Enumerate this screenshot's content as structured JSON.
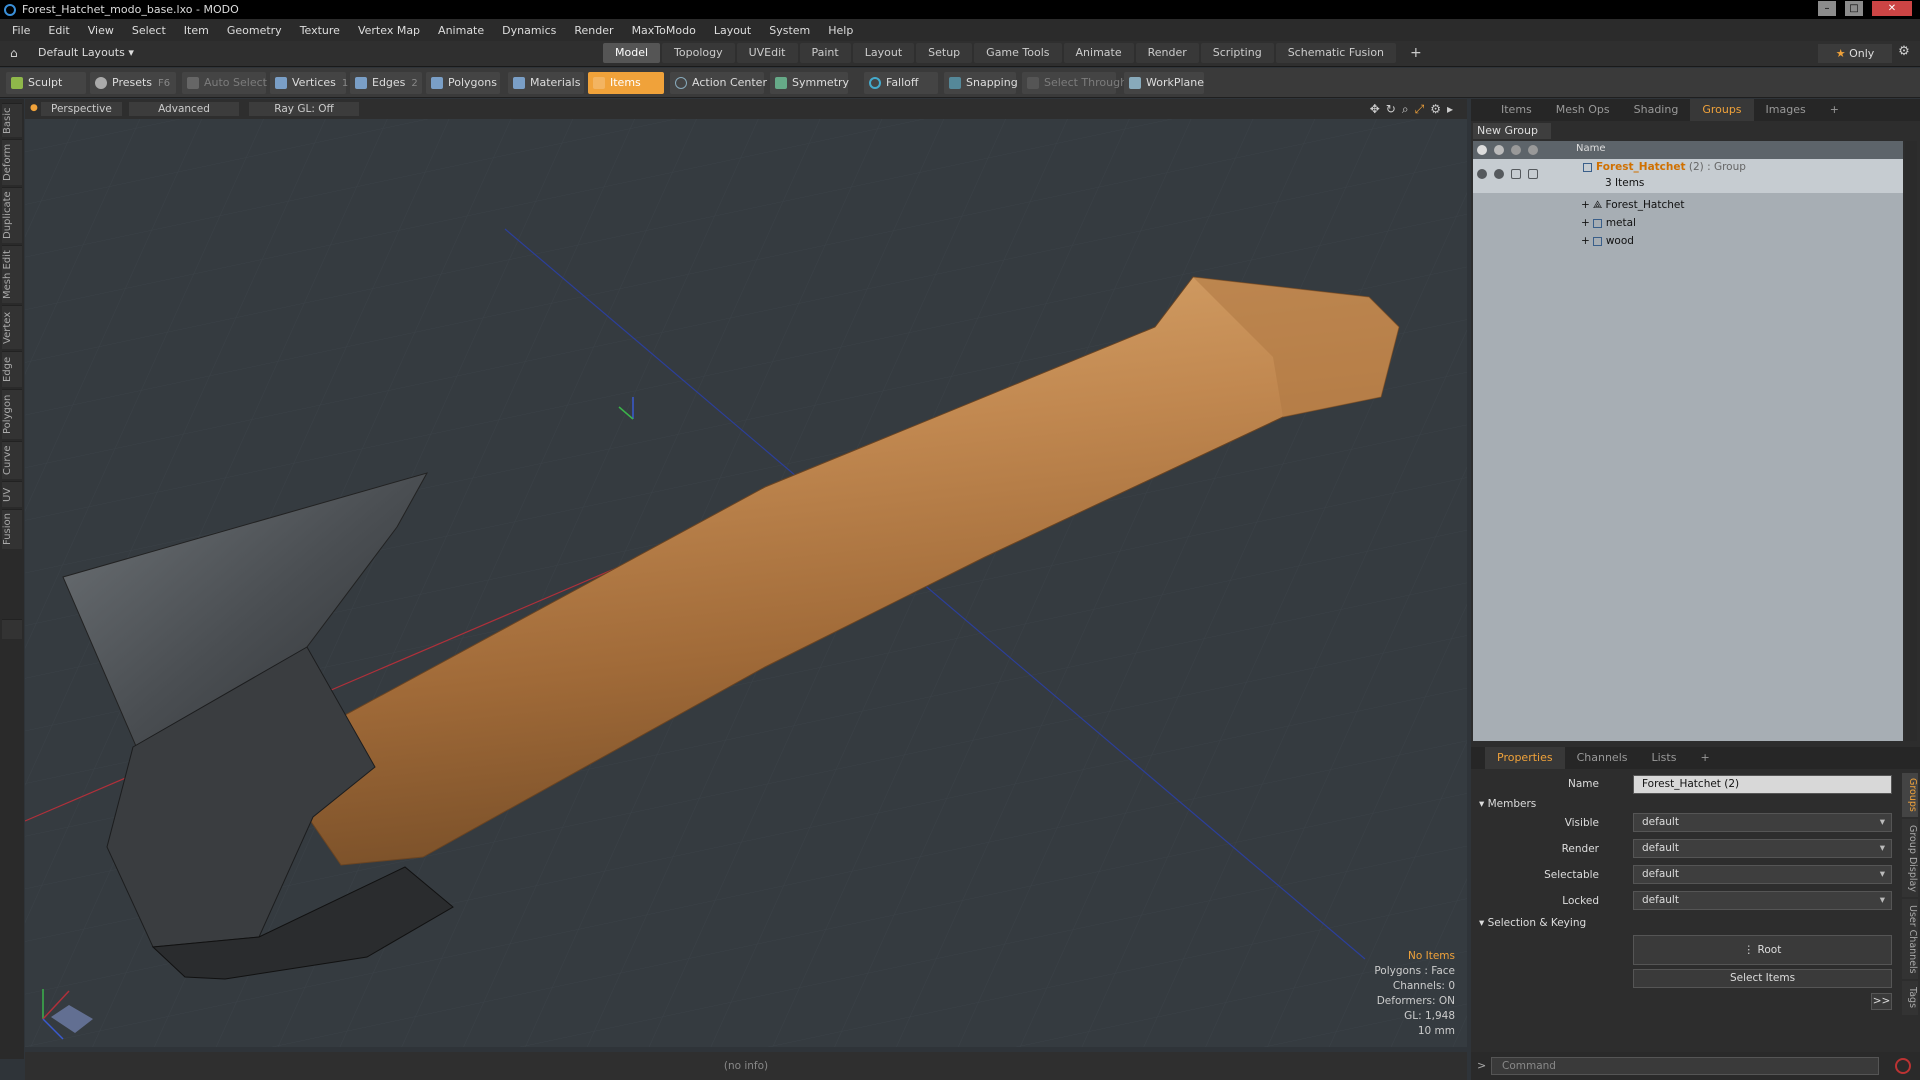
{
  "window": {
    "title": "Forest_Hatchet_modo_base.lxo - MODO"
  },
  "menu": [
    "File",
    "Edit",
    "View",
    "Select",
    "Item",
    "Geometry",
    "Texture",
    "Vertex Map",
    "Animate",
    "Dynamics",
    "Render",
    "MaxToModo",
    "Layout",
    "System",
    "Help"
  ],
  "layout": {
    "dropdown": "Default Layouts",
    "tabs": [
      "Model",
      "Topology",
      "UVEdit",
      "Paint",
      "Layout",
      "Setup",
      "Game Tools",
      "Animate",
      "Render",
      "Scripting",
      "Schematic Fusion"
    ],
    "active_tab": "Model",
    "add_symbol": "+",
    "only_label": "Only"
  },
  "toolbar": {
    "sculpt": "Sculpt",
    "presets": "Presets",
    "presets_key": "F6",
    "auto_select": "Auto Select",
    "vertices": "Vertices",
    "vertices_count": "1",
    "edges": "Edges",
    "edges_count": "2",
    "polygons": "Polygons",
    "materials": "Materials",
    "items": "Items",
    "action_center": "Action Center",
    "symmetry": "Symmetry",
    "falloff": "Falloff",
    "snapping": "Snapping",
    "select_through": "Select Through",
    "workplane": "WorkPlane"
  },
  "left_tabs": [
    "Basic",
    "Deform",
    "Duplicate",
    "Mesh Edit",
    "Vertex",
    "Edge",
    "Polygon",
    "Curve",
    "UV",
    "Fusion"
  ],
  "viewport": {
    "view": "Perspective",
    "shading": "Advanced",
    "raygl": "Ray GL: Off",
    "info": {
      "items": "No Items",
      "polygons": "Polygons : Face",
      "channels": "Channels: 0",
      "deformers": "Deformers: ON",
      "gl": "GL: 1,948",
      "scale": "10 mm"
    }
  },
  "right_panel": {
    "tabs": [
      "Items",
      "Mesh Ops",
      "Shading",
      "Groups",
      "Images"
    ],
    "active_tab": "Groups",
    "add_symbol": "+",
    "new_group": "New Group",
    "list_header": "Name",
    "group": {
      "name": "Forest_Hatchet",
      "suffix": "(2) : Group",
      "count": "3 Items"
    },
    "members": [
      "Forest_Hatchet",
      "metal",
      "wood"
    ]
  },
  "properties": {
    "tabs": [
      "Properties",
      "Channels",
      "Lists"
    ],
    "active_tab": "Properties",
    "add_symbol": "+",
    "name_label": "Name",
    "name_value": "Forest_Hatchet (2)",
    "members_section": "Members",
    "visible_label": "Visible",
    "visible_value": "default",
    "render_label": "Render",
    "render_value": "default",
    "selectable_label": "Selectable",
    "selectable_value": "default",
    "locked_label": "Locked",
    "locked_value": "default",
    "keying_section": "Selection & Keying",
    "root_button": "Root",
    "select_items_button": "Select Items",
    "more_button": ">>",
    "side_tabs": [
      "Groups",
      "Group Display",
      "User Channels",
      "Tags"
    ]
  },
  "status": {
    "info": "(no info)"
  },
  "command": {
    "placeholder": "Command",
    "prompt": ">"
  },
  "colors": {
    "accent": "#f0a23a",
    "viewport_bg": "#353b40",
    "group_list_bg": "#a7aeb4"
  }
}
